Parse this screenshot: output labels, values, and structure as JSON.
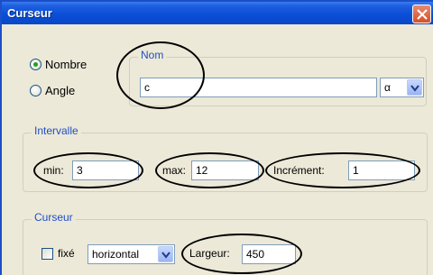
{
  "window": {
    "title": "Curseur"
  },
  "type_options": {
    "nombre": "Nombre",
    "angle": "Angle",
    "selected": "Nombre"
  },
  "nom": {
    "legend": "Nom",
    "value": "c",
    "symbol": "α"
  },
  "intervalle": {
    "legend": "Intervalle",
    "min_label": "min:",
    "min_value": "3",
    "max_label": "max:",
    "max_value": "12",
    "increment_label": "Incrément:",
    "increment_value": "1"
  },
  "curseur": {
    "legend": "Curseur",
    "fixe_label": "fixé",
    "orientation": "horizontal",
    "largeur_label": "Largeur:",
    "largeur_value": "450"
  }
}
